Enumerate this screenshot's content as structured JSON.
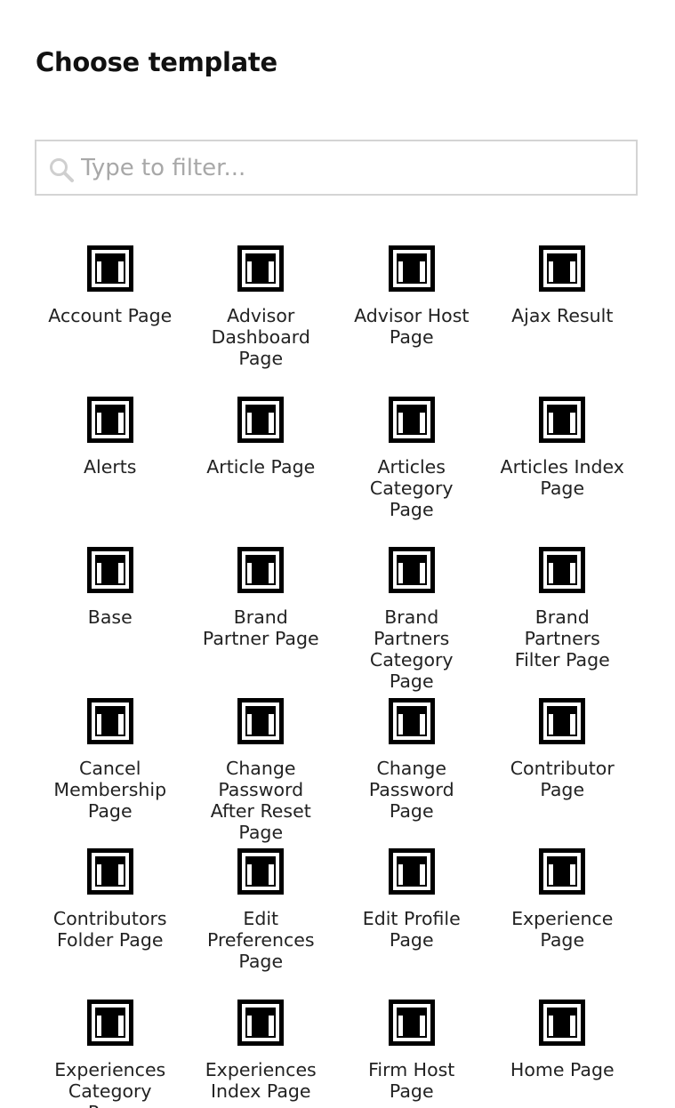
{
  "dialog": {
    "title": "Choose template"
  },
  "filter": {
    "placeholder": "Type to filter...",
    "value": "",
    "icon": "search-icon"
  },
  "templates": {
    "icon": "template-icon",
    "items": [
      {
        "label": "Account Page"
      },
      {
        "label": "Advisor Dashboard Page"
      },
      {
        "label": "Advisor Host Page"
      },
      {
        "label": "Ajax Result"
      },
      {
        "label": "Alerts"
      },
      {
        "label": "Article Page"
      },
      {
        "label": "Articles Category Page"
      },
      {
        "label": "Articles Index Page"
      },
      {
        "label": "Base"
      },
      {
        "label": "Brand Partner Page"
      },
      {
        "label": "Brand Partners Category Page"
      },
      {
        "label": "Brand Partners Filter Page"
      },
      {
        "label": "Cancel Membership Page"
      },
      {
        "label": "Change Password After Reset Page"
      },
      {
        "label": "Change Password Page"
      },
      {
        "label": "Contributor Page"
      },
      {
        "label": "Contributors Folder Page"
      },
      {
        "label": "Edit Preferences Page"
      },
      {
        "label": "Edit Profile Page"
      },
      {
        "label": "Experience Page"
      },
      {
        "label": "Experiences Category Page"
      },
      {
        "label": "Experiences Index Page"
      },
      {
        "label": "Firm Host Page"
      },
      {
        "label": "Home Page"
      }
    ]
  }
}
